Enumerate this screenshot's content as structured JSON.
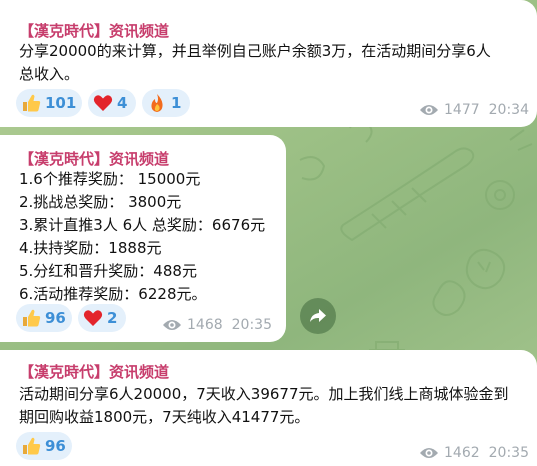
{
  "colors": {
    "channel_name": "#c73d6c",
    "reaction_bg": "#e4f0fb",
    "reaction_count": "#3d8fd6",
    "meta": "#a3aab0",
    "wallpaper": "#9fc287"
  },
  "messages": [
    {
      "channel": "【漢克時代】资讯频道",
      "lines": [
        "分享20000的来计算，并且举例自己账户余额3万，在活动期间分享6人",
        "总收入。"
      ],
      "reactions": [
        {
          "icon": "thumbs-up-icon",
          "count": "101"
        },
        {
          "icon": "heart-icon",
          "count": "4"
        },
        {
          "icon": "fire-icon",
          "count": "1"
        }
      ],
      "views": "1477",
      "time": "20:34"
    },
    {
      "channel": "【漢克時代】资讯频道",
      "lines": [
        "1.6个推荐奖励： 15000元",
        "2.挑战总奖励： 3800元",
        "3.累计直推3人 6人 总奖励：6676元",
        "4.扶持奖励：1888元",
        "5.分红和晋升奖励：488元",
        "6.活动推荐奖励：6228元。"
      ],
      "reactions": [
        {
          "icon": "thumbs-up-icon",
          "count": "96"
        },
        {
          "icon": "heart-icon",
          "count": "2"
        }
      ],
      "views": "1468",
      "time": "20:35"
    },
    {
      "channel": "【漢克時代】资讯频道",
      "lines": [
        "活动期间分享6人20000，7天收入39677元。加上我们线上商城体验金到",
        "期回购收益1800元，7天纯收入41477元。"
      ],
      "reactions": [
        {
          "icon": "thumbs-up-icon",
          "count": "96"
        }
      ],
      "views": "1462",
      "time": "20:35"
    }
  ],
  "share_button": {
    "icon": "share-arrow-icon"
  }
}
